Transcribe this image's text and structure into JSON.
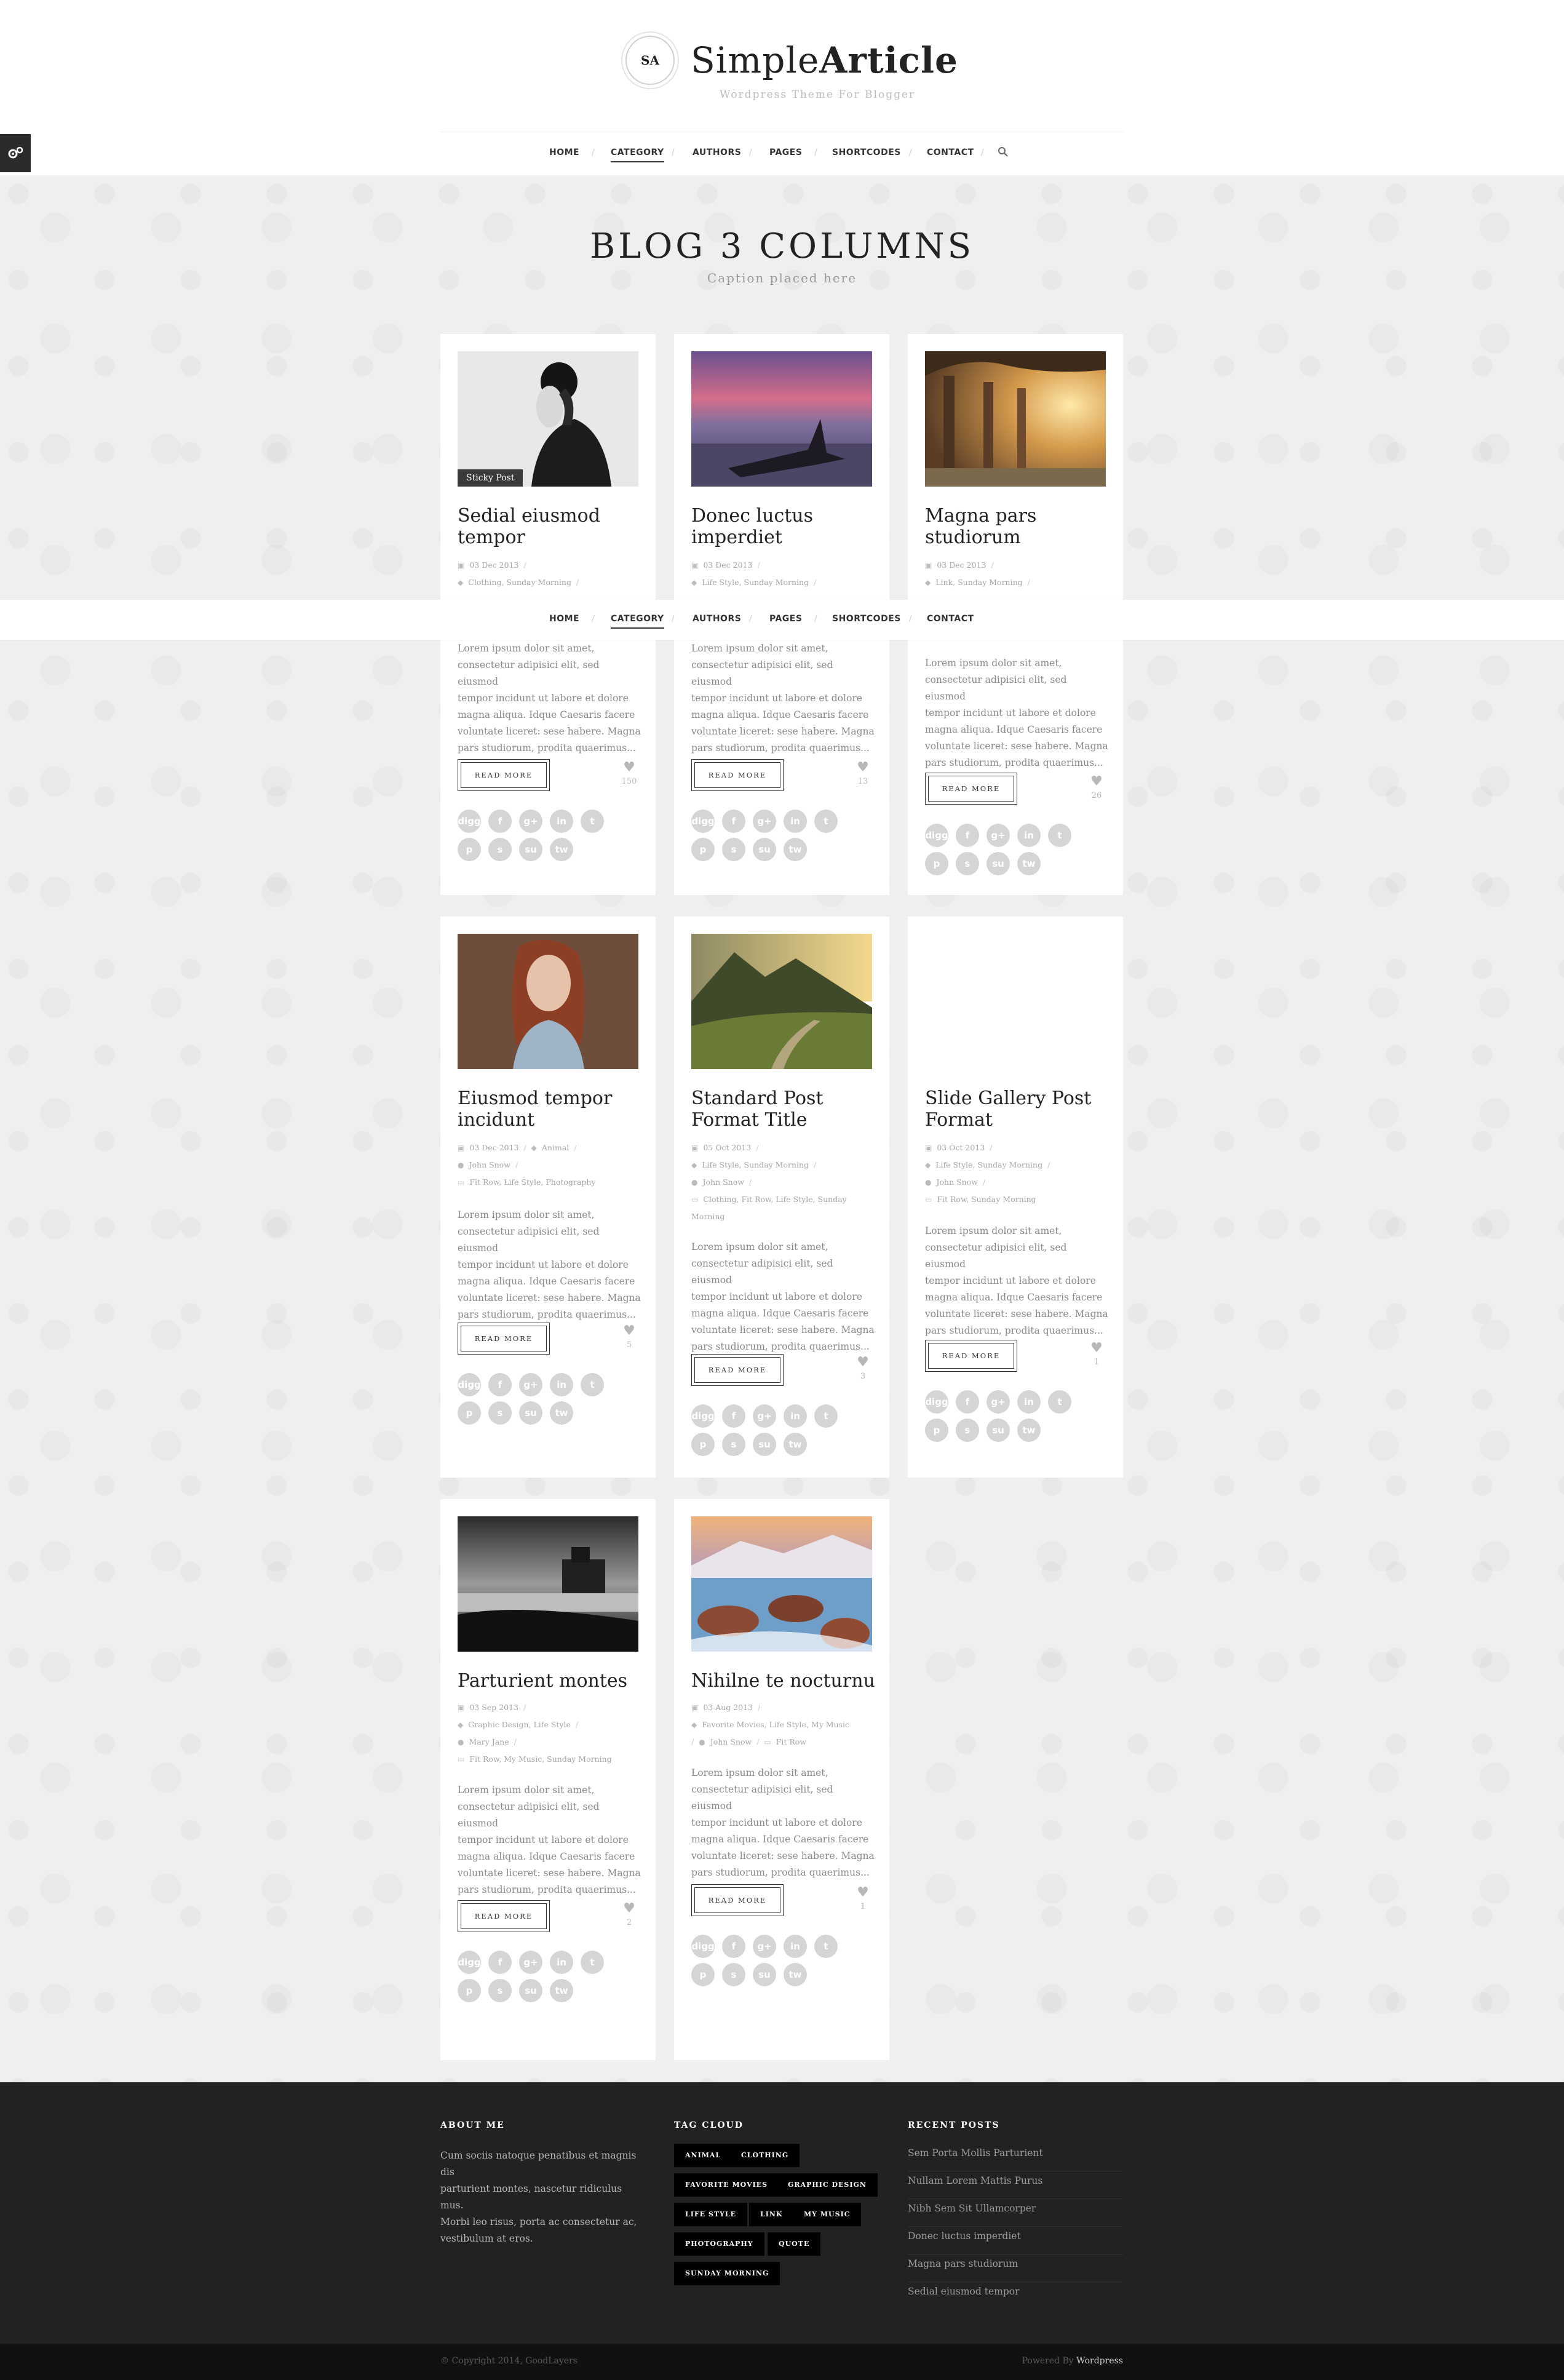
{
  "site": {
    "logo_badge": "SA",
    "name_light": "Simple",
    "name_bold": "Article",
    "tagline": "Wordpress Theme For Blogger"
  },
  "nav": {
    "items": [
      "HOME",
      "CATEGORY",
      "AUTHORS",
      "PAGES",
      "SHORTCODES",
      "CONTACT"
    ],
    "active": "CATEGORY",
    "search_icon": "search-icon",
    "settings_icon": "gear-icon"
  },
  "page": {
    "title": "BLOG 3 COLUMNS",
    "caption": "Caption placed here"
  },
  "read_more": "READ MORE",
  "share_icons": {
    "row1": [
      "digg",
      "f",
      "g+",
      "in",
      "t"
    ],
    "row2": [
      "p",
      "s",
      "su",
      "tw"
    ]
  },
  "posts": [
    {
      "title_lines": [
        "Sedial eiusmod",
        "tempor"
      ],
      "badge": "Sticky Post",
      "date": "03 Dec 2013",
      "categories": "Clothing, Sunday Morning",
      "excerpt_lines": [
        "Lorem ipsum dolor sit amet,",
        "consectetur adipisici elit, sed eiusmod",
        "tempor incidunt ut labore et dolore",
        "magna aliqua. Idque Caesaris facere",
        "voluntate liceret: sese habere. Magna",
        "pars studiorum, prodita quaerimus..."
      ],
      "likes": "150"
    },
    {
      "title_lines": [
        "Donec luctus",
        "imperdiet"
      ],
      "date": "03 Dec 2013",
      "categories": "Life Style, Sunday Morning",
      "excerpt_lines": [
        "Lorem ipsum dolor sit amet,",
        "consectetur adipisici elit, sed eiusmod",
        "tempor incidunt ut labore et dolore",
        "magna aliqua. Idque Caesaris facere",
        "voluntate liceret: sese habere. Magna",
        "pars studiorum, prodita quaerimus..."
      ],
      "likes": "13"
    },
    {
      "title_lines": [
        "Magna pars",
        "studiorum"
      ],
      "date": "03 Dec 2013",
      "categories": "Link, Sunday Morning",
      "excerpt_lines": [
        "Lorem ipsum dolor sit amet,",
        "consectetur adipisici elit, sed eiusmod",
        "tempor incidunt ut labore et dolore",
        "magna aliqua. Idque Caesaris facere",
        "voluntate liceret: sese habere. Magna",
        "pars studiorum, prodita quaerimus..."
      ],
      "likes": "26"
    },
    {
      "title_lines": [
        "Eiusmod tempor",
        "incidunt"
      ],
      "date": "03 Dec 2013",
      "categories": "Animal",
      "author": "John Snow",
      "tags": "Fit Row, Life Style, Photography",
      "excerpt_lines": [
        "Lorem ipsum dolor sit amet,",
        "consectetur adipisici elit, sed eiusmod",
        "tempor incidunt ut labore et dolore",
        "magna aliqua. Idque Caesaris facere",
        "voluntate liceret: sese habere. Magna",
        "pars studiorum, prodita quaerimus..."
      ],
      "likes": "5"
    },
    {
      "title_lines": [
        "Standard Post",
        "Format Title"
      ],
      "date": "05 Oct 2013",
      "categories": "Life Style, Sunday Morning",
      "author": "John Snow",
      "tags_lines": [
        "Clothing, Fit Row, Life Style, Sunday",
        "Morning"
      ],
      "excerpt_lines": [
        "Lorem ipsum dolor sit amet,",
        "consectetur adipisici elit, sed eiusmod",
        "tempor incidunt ut labore et dolore",
        "magna aliqua. Idque Caesaris facere",
        "voluntate liceret: sese habere. Magna",
        "pars studiorum, prodita quaerimus..."
      ],
      "likes": "3"
    },
    {
      "title_lines": [
        "Slide Gallery Post",
        "Format"
      ],
      "date": "03 Oct 2013",
      "categories": "Life Style, Sunday Morning",
      "author": "John Snow",
      "tags": "Fit Row, Sunday Morning",
      "excerpt_lines": [
        "Lorem ipsum dolor sit amet,",
        "consectetur adipisici elit, sed eiusmod",
        "tempor incidunt ut labore et dolore",
        "magna aliqua. Idque Caesaris facere",
        "voluntate liceret: sese habere. Magna",
        "pars studiorum, prodita quaerimus..."
      ],
      "likes": "1"
    },
    {
      "title_lines": [
        "Parturient montes"
      ],
      "date": "03 Sep 2013",
      "categories": "Graphic Design, Life Style",
      "author": "Mary Jane",
      "tags": "Fit Row, My Music, Sunday Morning",
      "excerpt_lines": [
        "Lorem ipsum dolor sit amet,",
        "consectetur adipisici elit, sed eiusmod",
        "tempor incidunt ut labore et dolore",
        "magna aliqua. Idque Caesaris facere",
        "voluntate liceret: sese habere. Magna",
        "pars studiorum, prodita quaerimus..."
      ],
      "likes": "2"
    },
    {
      "title_lines": [
        "Nihilne te nocturnu"
      ],
      "date": "03 Aug 2013",
      "categories": "Favorite Movies, Life Style, My Music",
      "author": "John Snow",
      "tags": "Fit Row",
      "excerpt_lines": [
        "Lorem ipsum dolor sit amet,",
        "consectetur adipisici elit, sed eiusmod",
        "tempor incidunt ut labore et dolore",
        "magna aliqua. Idque Caesaris facere",
        "voluntate liceret: sese habere. Magna",
        "pars studiorum, prodita quaerimus..."
      ],
      "likes": "1"
    }
  ],
  "footer": {
    "about_title": "ABOUT ME",
    "about_lines": [
      "Cum sociis natoque penatibus et magnis dis",
      "parturient montes, nascetur ridiculus mus.",
      "Morbi leo risus, porta ac consectetur ac,",
      "vestibulum at eros."
    ],
    "tag_title": "TAG CLOUD",
    "tags": [
      "ANIMAL",
      "CLOTHING",
      "FAVORITE MOVIES",
      "GRAPHIC DESIGN",
      "LIFE STYLE",
      "LINK",
      "MY MUSIC",
      "PHOTOGRAPHY",
      "QUOTE",
      "SUNDAY MORNING"
    ],
    "recent_title": "RECENT POSTS",
    "recent": [
      "Sem Porta Mollis Parturient",
      "Nullam Lorem Mattis Purus",
      "Nibh Sem Sit Ullamcorper",
      "Donec luctus imperdiet",
      "Magna pars studiorum",
      "Sedial eiusmod tempor"
    ],
    "copyright": "© Copyright 2014, GoodLayers",
    "powered_prefix": "Powered By",
    "powered_name": "Wordpress"
  }
}
